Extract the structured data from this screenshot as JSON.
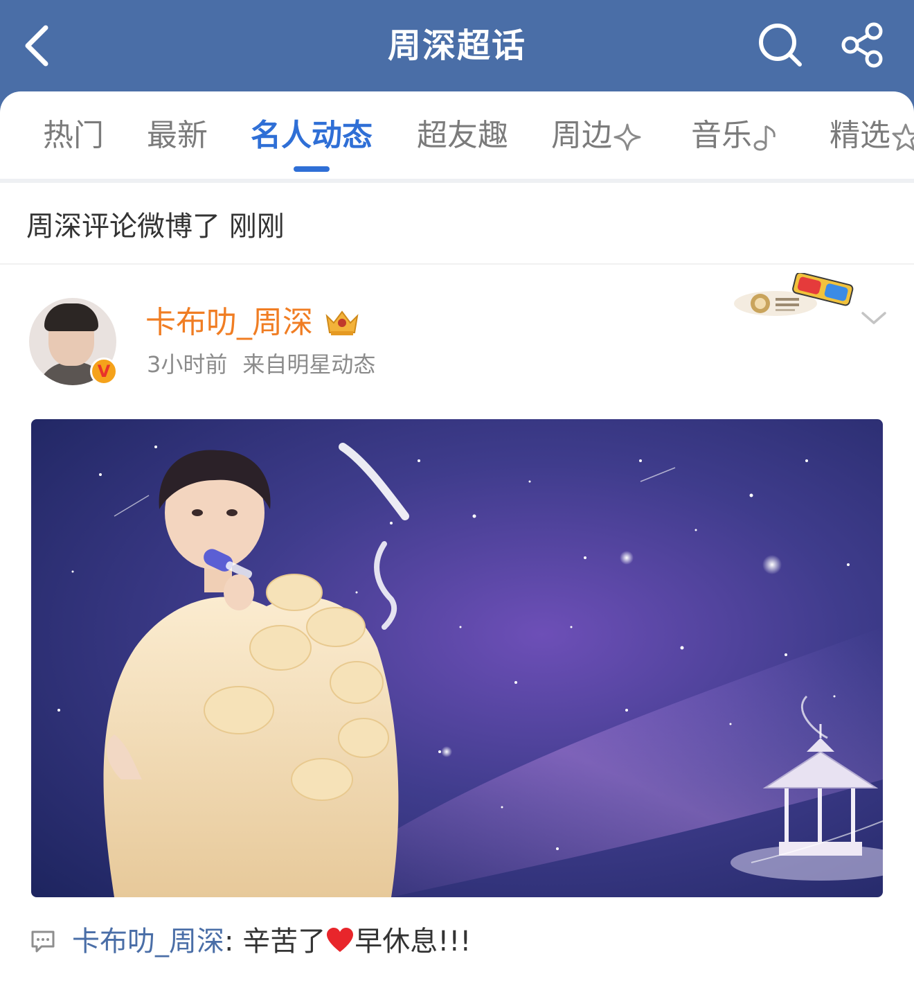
{
  "header": {
    "title": "周深超话",
    "back_icon": "chevron-left-icon",
    "search_icon": "search-icon",
    "share_icon": "share-icon",
    "background_color": "#4a6ea7"
  },
  "tabs": [
    {
      "label": "热门",
      "active": false
    },
    {
      "label": "最新",
      "active": false
    },
    {
      "label": "名人动态",
      "active": true
    },
    {
      "label": "超友趣",
      "active": false
    },
    {
      "label": "周边",
      "icon": "sparkle-icon",
      "active": false
    },
    {
      "label": "音乐",
      "icon": "music-note-icon",
      "active": false
    },
    {
      "label": "精选",
      "icon": "star-icon",
      "active": false
    }
  ],
  "activity": {
    "text": "周深评论微博了 刚刚"
  },
  "post": {
    "author": "卡布叻_周深",
    "time": "3小时前",
    "source": "来自明星动态",
    "avatar_icon": "avatar",
    "verified_icon": "verified-badge",
    "expand_icon": "chevron-down-icon",
    "image_alt": "singer-on-starry-stage"
  },
  "comment": {
    "author": "卡布叻_周深",
    "separator": ":",
    "text_before": " 辛苦了",
    "text_after": "早休息!!!",
    "icon": "comment-icon"
  },
  "colors": {
    "accent": "#2f6fd6",
    "username": "#f07d23",
    "link": "#4a6ea7"
  }
}
